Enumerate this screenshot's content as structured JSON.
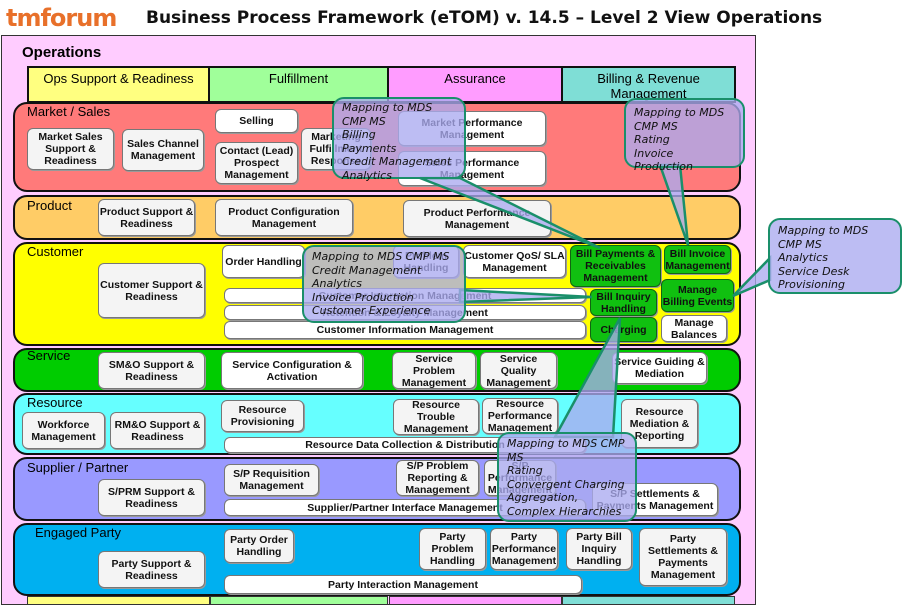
{
  "header": {
    "logo": "tmforum",
    "title": "Business Process Framework (eTOM) v. 14.5 – Level 2 View Operations"
  },
  "operations_label": "Operations",
  "columns": [
    {
      "label": "Ops Support & Readiness",
      "color": "#ffff80"
    },
    {
      "label": "Fulfillment",
      "color": "#a0ff9a"
    },
    {
      "label": "Assurance",
      "color": "#ff9cff"
    },
    {
      "label": "Billing & Revenue Management",
      "color": "#7fded6"
    }
  ],
  "bands": {
    "market_sales": {
      "label": "Market / Sales",
      "color": "#ff7a7a",
      "processes": [
        "Market Sales Support & Readiness",
        "Sales Channel Management",
        "Selling",
        "Contact (Lead) Prospect Management",
        "Marketing Fulfillment Response",
        "Market Performance Management",
        "Sales Performance Management"
      ]
    },
    "product": {
      "label": "Product",
      "color": "#ffcc66",
      "processes": [
        "Product Support & Readiness",
        "Product Configuration Management",
        "Product Performance Management"
      ]
    },
    "customer": {
      "label": "Customer",
      "color": "#ffff00",
      "processes": [
        "Customer Support & Readiness",
        "Order Handling",
        "Problem Handling",
        "Customer QoS/ SLA Management",
        "Bill Payments & Receivables Management",
        "Bill Invoice Management",
        "Bill Inquiry Handling",
        "Manage Billing Events",
        "Charging",
        "Manage Balances",
        "Customer Interaction Management",
        "Retention & Loyalty Management",
        "Customer Information Management"
      ]
    },
    "service": {
      "label": "Service",
      "color": "#00cc00",
      "processes": [
        "SM&O Support & Readiness",
        "Service Configuration & Activation",
        "Service Problem Management",
        "Service Quality Management",
        "Service Guiding & Mediation"
      ]
    },
    "resource": {
      "label": "Resource",
      "color": "#66ffff",
      "processes": [
        "Workforce Management",
        "RM&O Support & Readiness",
        "Resource Provisioning",
        "Resource Trouble Management",
        "Resource Performance Management",
        "Resource Mediation & Reporting",
        "Resource Data Collection & Distribution"
      ]
    },
    "supplier_partner": {
      "label": "Supplier / Partner",
      "color": "#9999ff",
      "processes": [
        "S/PRM Support & Readiness",
        "S/P Requisition Management",
        "S/P Problem Reporting & Management",
        "S/P Performance Management",
        "S/P Settlements & Payments Management",
        "Supplier/Partner Interface Management"
      ]
    },
    "engaged_party": {
      "label": "Engaged Party",
      "color": "#00b0f0",
      "processes": [
        "Party Support & Readiness",
        "Party Order Handling",
        "Party Problem Handling",
        "Party Performance Management",
        "Party Bill Inquiry Handling",
        "Party Settlements & Payments Management",
        "Party Interaction Management"
      ]
    }
  },
  "callouts": [
    {
      "lines": [
        "Mapping to MDS",
        "CMP MS",
        "Billing",
        "Payments",
        "Credit Management",
        "Analytics"
      ]
    },
    {
      "lines": [
        "Mapping to MDS",
        "CMP MS",
        "Rating",
        "Invoice Production"
      ]
    },
    {
      "lines": [
        "Mapping to MDS",
        "CMP MS",
        "Analytics",
        "Service Desk",
        "Provisioning"
      ]
    },
    {
      "lines": [
        "Mapping to MDS CMP MS",
        "Credit Management",
        "Analytics",
        "Invoice Production",
        "Customer Experience"
      ]
    },
    {
      "lines": [
        "Mapping to MDS CMP",
        "MS",
        "Rating",
        "Convergent Charging",
        "Aggregation,",
        "Complex Hierarchies"
      ]
    }
  ]
}
